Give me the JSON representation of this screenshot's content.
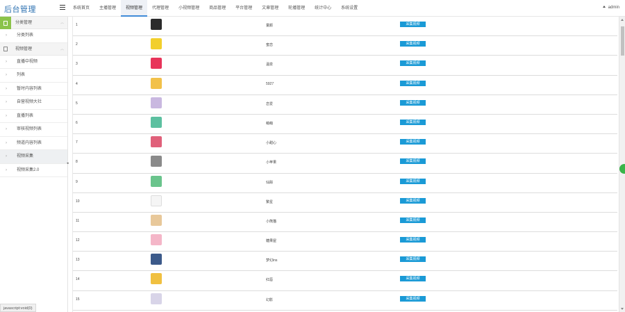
{
  "app": {
    "title": "后台管理",
    "user": "admin"
  },
  "nav": [
    {
      "label": "系统首页",
      "active": false
    },
    {
      "label": "主播管理",
      "active": false
    },
    {
      "label": "视频管理",
      "active": true
    },
    {
      "label": "代理管理",
      "active": false
    },
    {
      "label": "小视频管理",
      "active": false
    },
    {
      "label": "商品管理",
      "active": false
    },
    {
      "label": "平台管理",
      "active": false
    },
    {
      "label": "文章管理",
      "active": false
    },
    {
      "label": "轮播管理",
      "active": false
    },
    {
      "label": "统计中心",
      "active": false
    },
    {
      "label": "系统设置",
      "active": false
    }
  ],
  "sidebar": {
    "groups": [
      {
        "label": "分类管理",
        "items": [
          {
            "label": "分类列表",
            "active": false
          }
        ]
      },
      {
        "label": "视频管理",
        "items": [
          {
            "label": "直播中视频",
            "active": false
          },
          {
            "label": "列表",
            "active": false
          },
          {
            "label": "暂时内容列表",
            "active": false
          },
          {
            "label": "自营视频大社",
            "active": false
          },
          {
            "label": "直播列表",
            "active": false
          },
          {
            "label": "审核视频列表",
            "active": false
          },
          {
            "label": "频道内容列表",
            "active": false
          },
          {
            "label": "视频采集",
            "active": true
          },
          {
            "label": "视频采集2.0",
            "active": false
          }
        ]
      }
    ]
  },
  "table": {
    "button_label": "采集视频",
    "rows": [
      {
        "index": "1",
        "name": "童颜",
        "color": "#2b2b2b"
      },
      {
        "index": "2",
        "name": "蜜恋",
        "color": "#f2cf2c"
      },
      {
        "index": "3",
        "name": "温泉",
        "color": "#e8345a"
      },
      {
        "index": "4",
        "name": "5927",
        "color": "#f2c14a"
      },
      {
        "index": "5",
        "name": "恋爱",
        "color": "#c9b8e0"
      },
      {
        "index": "6",
        "name": "萌萌",
        "color": "#5cc0a0"
      },
      {
        "index": "7",
        "name": "小甜心",
        "color": "#e0607a"
      },
      {
        "index": "8",
        "name": "小苹果",
        "color": "#8a8a8a"
      },
      {
        "index": "9",
        "name": "仙踪",
        "color": "#6ac48c"
      },
      {
        "index": "10",
        "name": "繁星",
        "color": "#f5f5f5"
      },
      {
        "index": "11",
        "name": "小熊猫",
        "color": "#e8c89a"
      },
      {
        "index": "12",
        "name": "糖果屋",
        "color": "#f4b6c8"
      },
      {
        "index": "13",
        "name": "梦幻ins",
        "color": "#3c5a8a"
      },
      {
        "index": "14",
        "name": "红唇",
        "color": "#f0c040"
      },
      {
        "index": "15",
        "name": "幻影",
        "color": "#d8d4e8"
      }
    ]
  },
  "status_bar": "javascript:void(0)"
}
